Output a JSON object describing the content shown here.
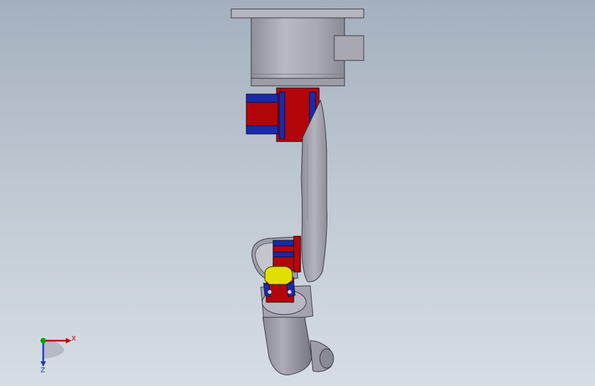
{
  "viewport": {
    "background_top": "#a4b0be",
    "background_bottom": "#d7dde4"
  },
  "model": {
    "colors": {
      "housing": "#a5a5b1",
      "joint_red": "#b2060b",
      "joint_blue": "#1a2aa8",
      "gripper_yellow": "#e0e000",
      "link_gray": "#a3a3ae",
      "dark_gray": "#6f6f78"
    }
  },
  "triad": {
    "x_label": "X",
    "z_label": "Z",
    "x_color": "#c00000",
    "y_color": "#00a000",
    "z_color": "#1a3ac8"
  }
}
